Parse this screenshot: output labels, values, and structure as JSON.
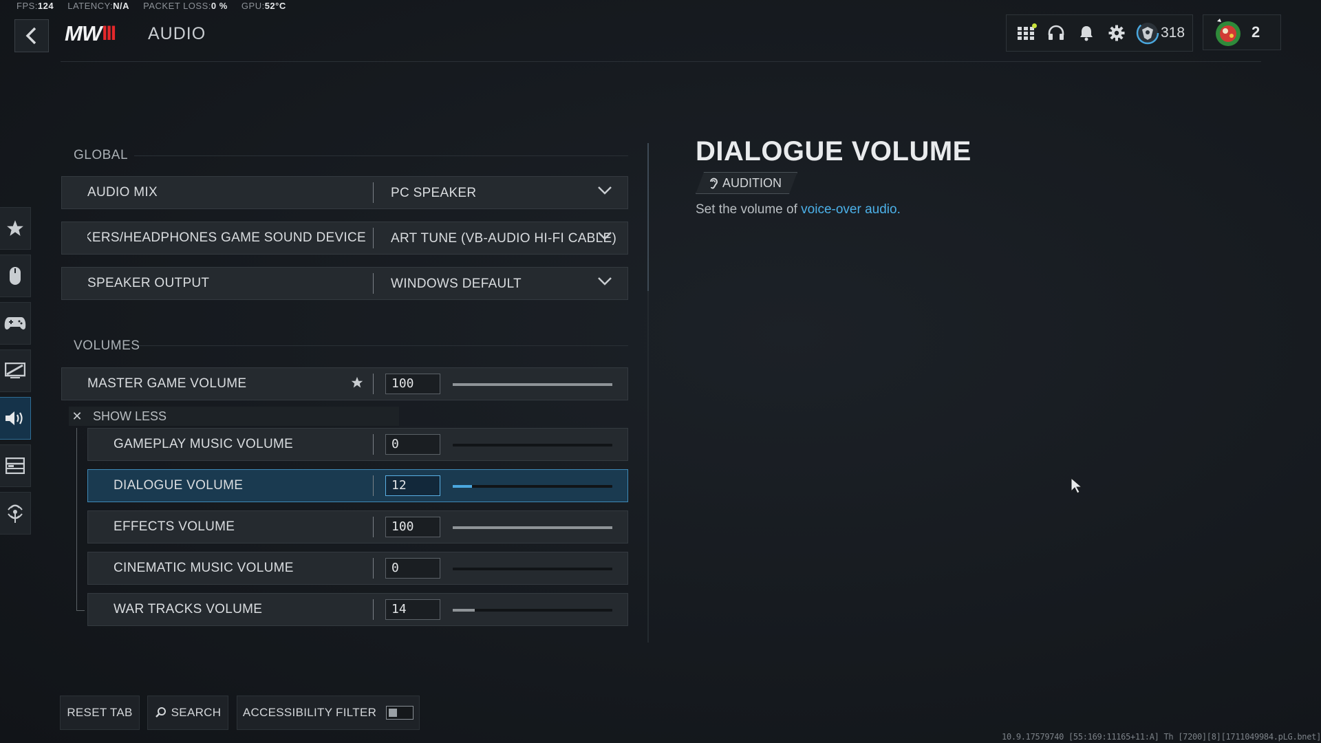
{
  "perf": {
    "fps_label": "FPS:",
    "fps_value": "124",
    "latency_label": "LATENCY:",
    "latency_value": "N/A",
    "packet_label": "PACKET LOSS:",
    "packet_value": "0 %",
    "gpu_label": "GPU:",
    "gpu_value": "52°C"
  },
  "header": {
    "logo_text": "MW",
    "logo_mark": "III",
    "title": "AUDIO",
    "cod_points": "318",
    "player_level": "2"
  },
  "colors": {
    "accent": "#4aa7de",
    "selected_row": "#1a3a50",
    "link": "#4cb1e9"
  },
  "rail_icons": [
    "star-icon",
    "mouse-icon",
    "controller-icon",
    "display-icon",
    "speaker-icon",
    "interface-icon",
    "network-icon"
  ],
  "global": {
    "title": "GLOBAL",
    "rows": [
      {
        "label": "AUDIO MIX",
        "value": "PC SPEAKER"
      },
      {
        "label": "SPEAKERS/HEADPHONES GAME SOUND DEVICE",
        "value": "ART TUNE (VB-AUDIO HI-FI CABLE)"
      },
      {
        "label": "SPEAKER OUTPUT",
        "value": "WINDOWS DEFAULT"
      }
    ]
  },
  "volumes": {
    "title": "VOLUMES",
    "master": {
      "label": "MASTER GAME VOLUME",
      "value": "100",
      "level": 100
    },
    "show_less": "SHOW LESS",
    "sub": [
      {
        "label": "GAMEPLAY MUSIC VOLUME",
        "value": "0",
        "level": 0
      },
      {
        "label": "DIALOGUE VOLUME",
        "value": "12",
        "level": 12
      },
      {
        "label": "EFFECTS VOLUME",
        "value": "100",
        "level": 100
      },
      {
        "label": "CINEMATIC MUSIC VOLUME",
        "value": "0",
        "level": 0
      },
      {
        "label": "WAR TRACKS VOLUME",
        "value": "14",
        "level": 14
      }
    ]
  },
  "detail": {
    "title": "DIALOGUE VOLUME",
    "tag": "AUDITION",
    "desc_prefix": "Set the volume of ",
    "desc_link": "voice-over audio."
  },
  "footer": {
    "reset": "RESET TAB",
    "search": "SEARCH",
    "accessibility": "ACCESSIBILITY FILTER",
    "build": "10.9.17579740 [55:169:11165+11:A] Th [7200][8][1711049984.pLG.bnet]"
  }
}
